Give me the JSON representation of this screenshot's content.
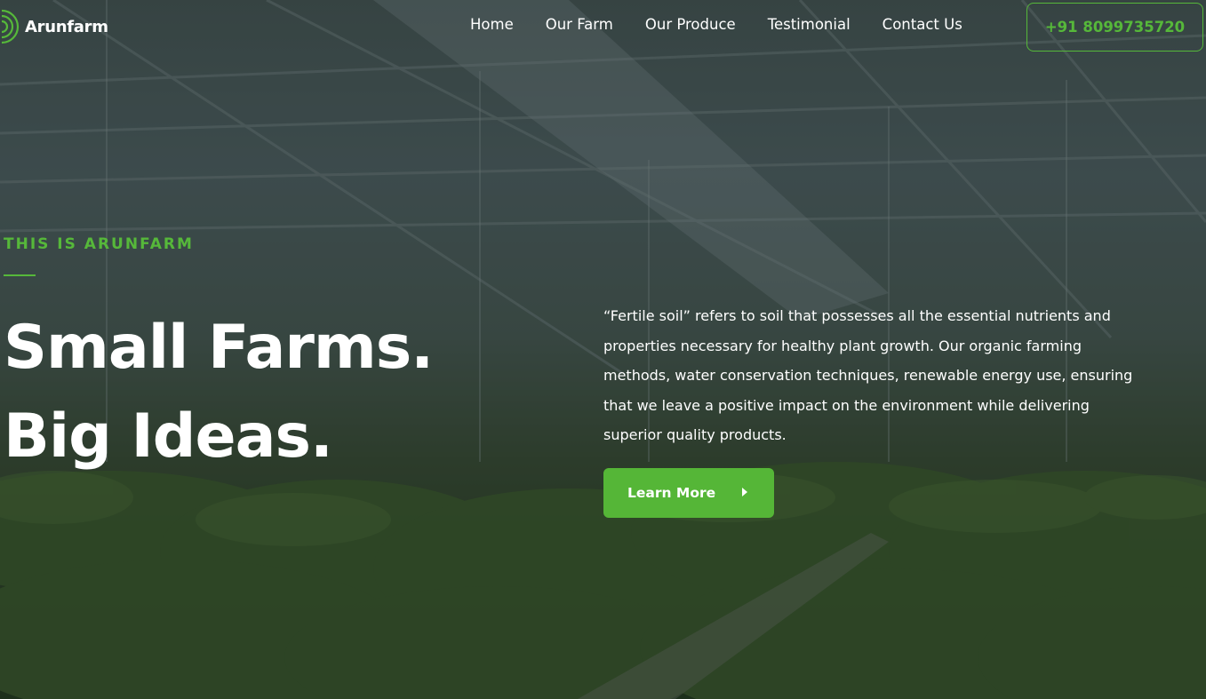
{
  "brand": {
    "name": "Arunfarm"
  },
  "nav": {
    "items": [
      {
        "label": "Home"
      },
      {
        "label": "Our Farm"
      },
      {
        "label": "Our Produce"
      },
      {
        "label": "Testimonial"
      },
      {
        "label": "Contact Us"
      }
    ],
    "phone_label": "+91 8099735720"
  },
  "hero": {
    "eyebrow": "THIS IS ARUNFARM",
    "headline_line1": "Small Farms.",
    "headline_line2": "Big Ideas.",
    "description": "“Fertile soil” refers to soil that possesses all the essential nutrients and properties necessary for healthy plant growth.  Our organic farming methods, water conservation techniques, renewable energy use, ensuring that we leave a positive impact on the environment while delivering superior quality products.",
    "cta_label": "Learn More"
  },
  "colors": {
    "accent": "#56b83a",
    "text": "#ffffff"
  },
  "icons": {
    "logo": "concentric-arcs-logo-icon",
    "cta": "caret-right-icon"
  }
}
